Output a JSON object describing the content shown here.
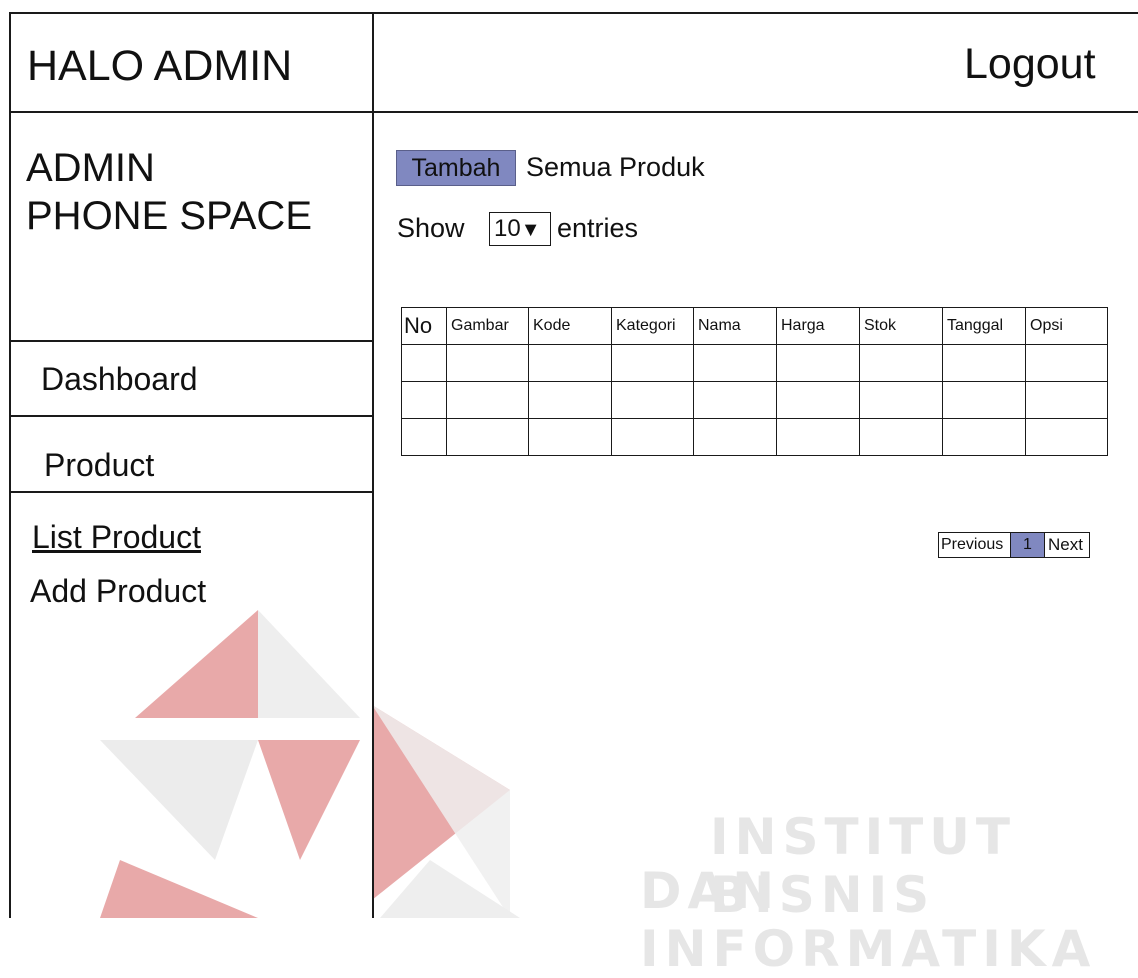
{
  "header": {
    "greeting": "HALO ADMIN",
    "logout_label": "Logout"
  },
  "sidebar": {
    "brand_line1": "ADMIN",
    "brand_line2": "PHONE SPACE",
    "menu": {
      "dashboard": "Dashboard",
      "product": "Product"
    },
    "submenu": {
      "list_product": "List Product",
      "add_product": "Add Product"
    }
  },
  "main": {
    "add_button": "Tambah",
    "heading": "Semua Produk",
    "show_label": "Show",
    "entries_value": "10",
    "entries_label": "entries",
    "table": {
      "columns": [
        "No",
        "Gambar",
        "Kode",
        "Kategori",
        "Nama",
        "Harga",
        "Stok",
        "Tanggal",
        "Opsi"
      ],
      "rows": [
        [
          "",
          "",
          "",
          "",
          "",
          "",
          "",
          "",
          ""
        ],
        [
          "",
          "",
          "",
          "",
          "",
          "",
          "",
          "",
          ""
        ],
        [
          "",
          "",
          "",
          "",
          "",
          "",
          "",
          "",
          ""
        ]
      ]
    },
    "pagination": {
      "previous": "Previous",
      "current": "1",
      "next": "Next"
    }
  },
  "watermark": {
    "line1": "INSTITUT BISNIS",
    "line2": "DAN INFORMATIKA"
  },
  "colors": {
    "accent": "#8088c0",
    "border": "#1a1a1a",
    "watermark_red": "#e8a9a9",
    "watermark_gray": "#e6e6e6"
  }
}
